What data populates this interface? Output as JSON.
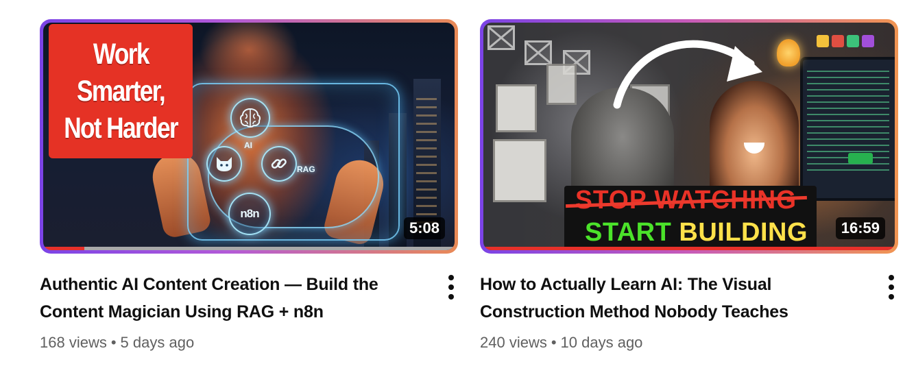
{
  "videos": [
    {
      "thumbnail_text": [
        "Work",
        "Smarter,",
        "Not Harder"
      ],
      "thumbnail_node_labels": {
        "ai": "AI",
        "rag": "RAG",
        "n8n": "n8n"
      },
      "duration": "5:08",
      "watched_fraction": 0.1,
      "title_lines": [
        "Authentic AI Content Creation — Build the",
        "Content Magician Using RAG + n8n"
      ],
      "views": "168 views",
      "separator": "•",
      "age": "5 days ago",
      "menu_icon": "more-vertical-icon"
    },
    {
      "thumbnail_text": {
        "stop_line": "STOP WATCHING",
        "start_word": "START",
        "building_word": "BUILDING"
      },
      "duration": "16:59",
      "watched_fraction": 1.0,
      "title_lines": [
        "How to Actually Learn AI: The Visual",
        "Construction Method Nobody Teaches"
      ],
      "views": "240 views",
      "separator": "•",
      "age": "10 days ago",
      "menu_icon": "more-vertical-icon"
    }
  ],
  "colors": {
    "progress": "#e7302a",
    "label_red": "#e53225",
    "stop_red": "#e93227",
    "start_green": "#4be22a",
    "title_text": "#0f0f0f",
    "meta_text": "#606060"
  }
}
